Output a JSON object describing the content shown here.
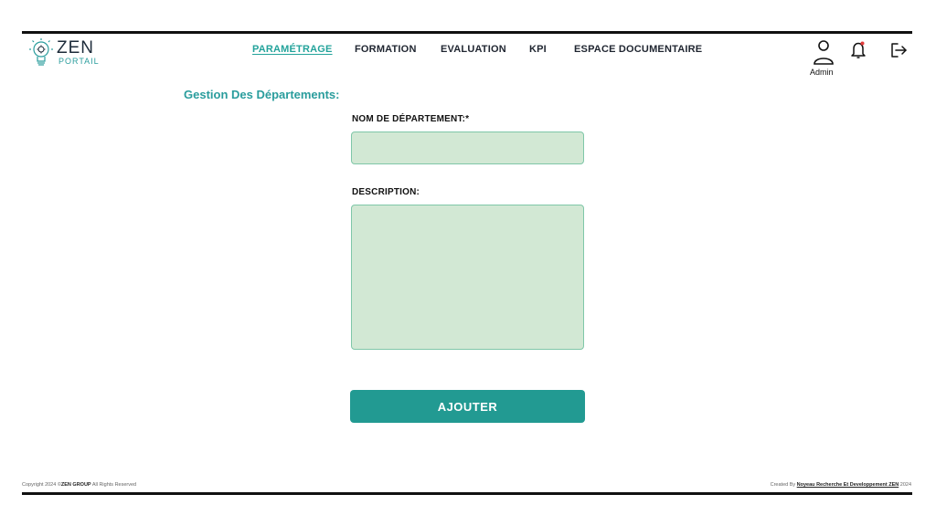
{
  "brand": {
    "name": "ZEN",
    "sub": "PORTAIL",
    "accent": "#2a9d9d"
  },
  "nav": {
    "items": [
      {
        "label": "PARAMÉTRAGE",
        "active": true
      },
      {
        "label": "FORMATION",
        "active": false
      },
      {
        "label": "EVALUATION",
        "active": false
      },
      {
        "label": "KPI",
        "active": false
      },
      {
        "label": "ESPACE DOCUMENTAIRE",
        "active": false
      }
    ]
  },
  "header": {
    "user_label": "Admin",
    "icons": [
      "user-icon",
      "bell-icon",
      "logout-icon"
    ]
  },
  "page": {
    "title": "Gestion Des Départements:"
  },
  "form": {
    "name_label": "NOM DE DÉPARTEMENT:*",
    "name_value": "",
    "description_label": "DESCRIPTION:",
    "description_value": "",
    "submit_label": "AJOUTER",
    "button_color": "#229a92",
    "field_color": "#d2e8d4"
  },
  "footer": {
    "left_prefix": "Copyright 2024 ©",
    "left_bold": "ZEN GROUP",
    "left_suffix": " All Rights Reserved",
    "right_prefix": "Created By ",
    "right_bold": "Noyeau Recherche Et Developpement ZEN",
    "right_suffix": " 2024"
  }
}
